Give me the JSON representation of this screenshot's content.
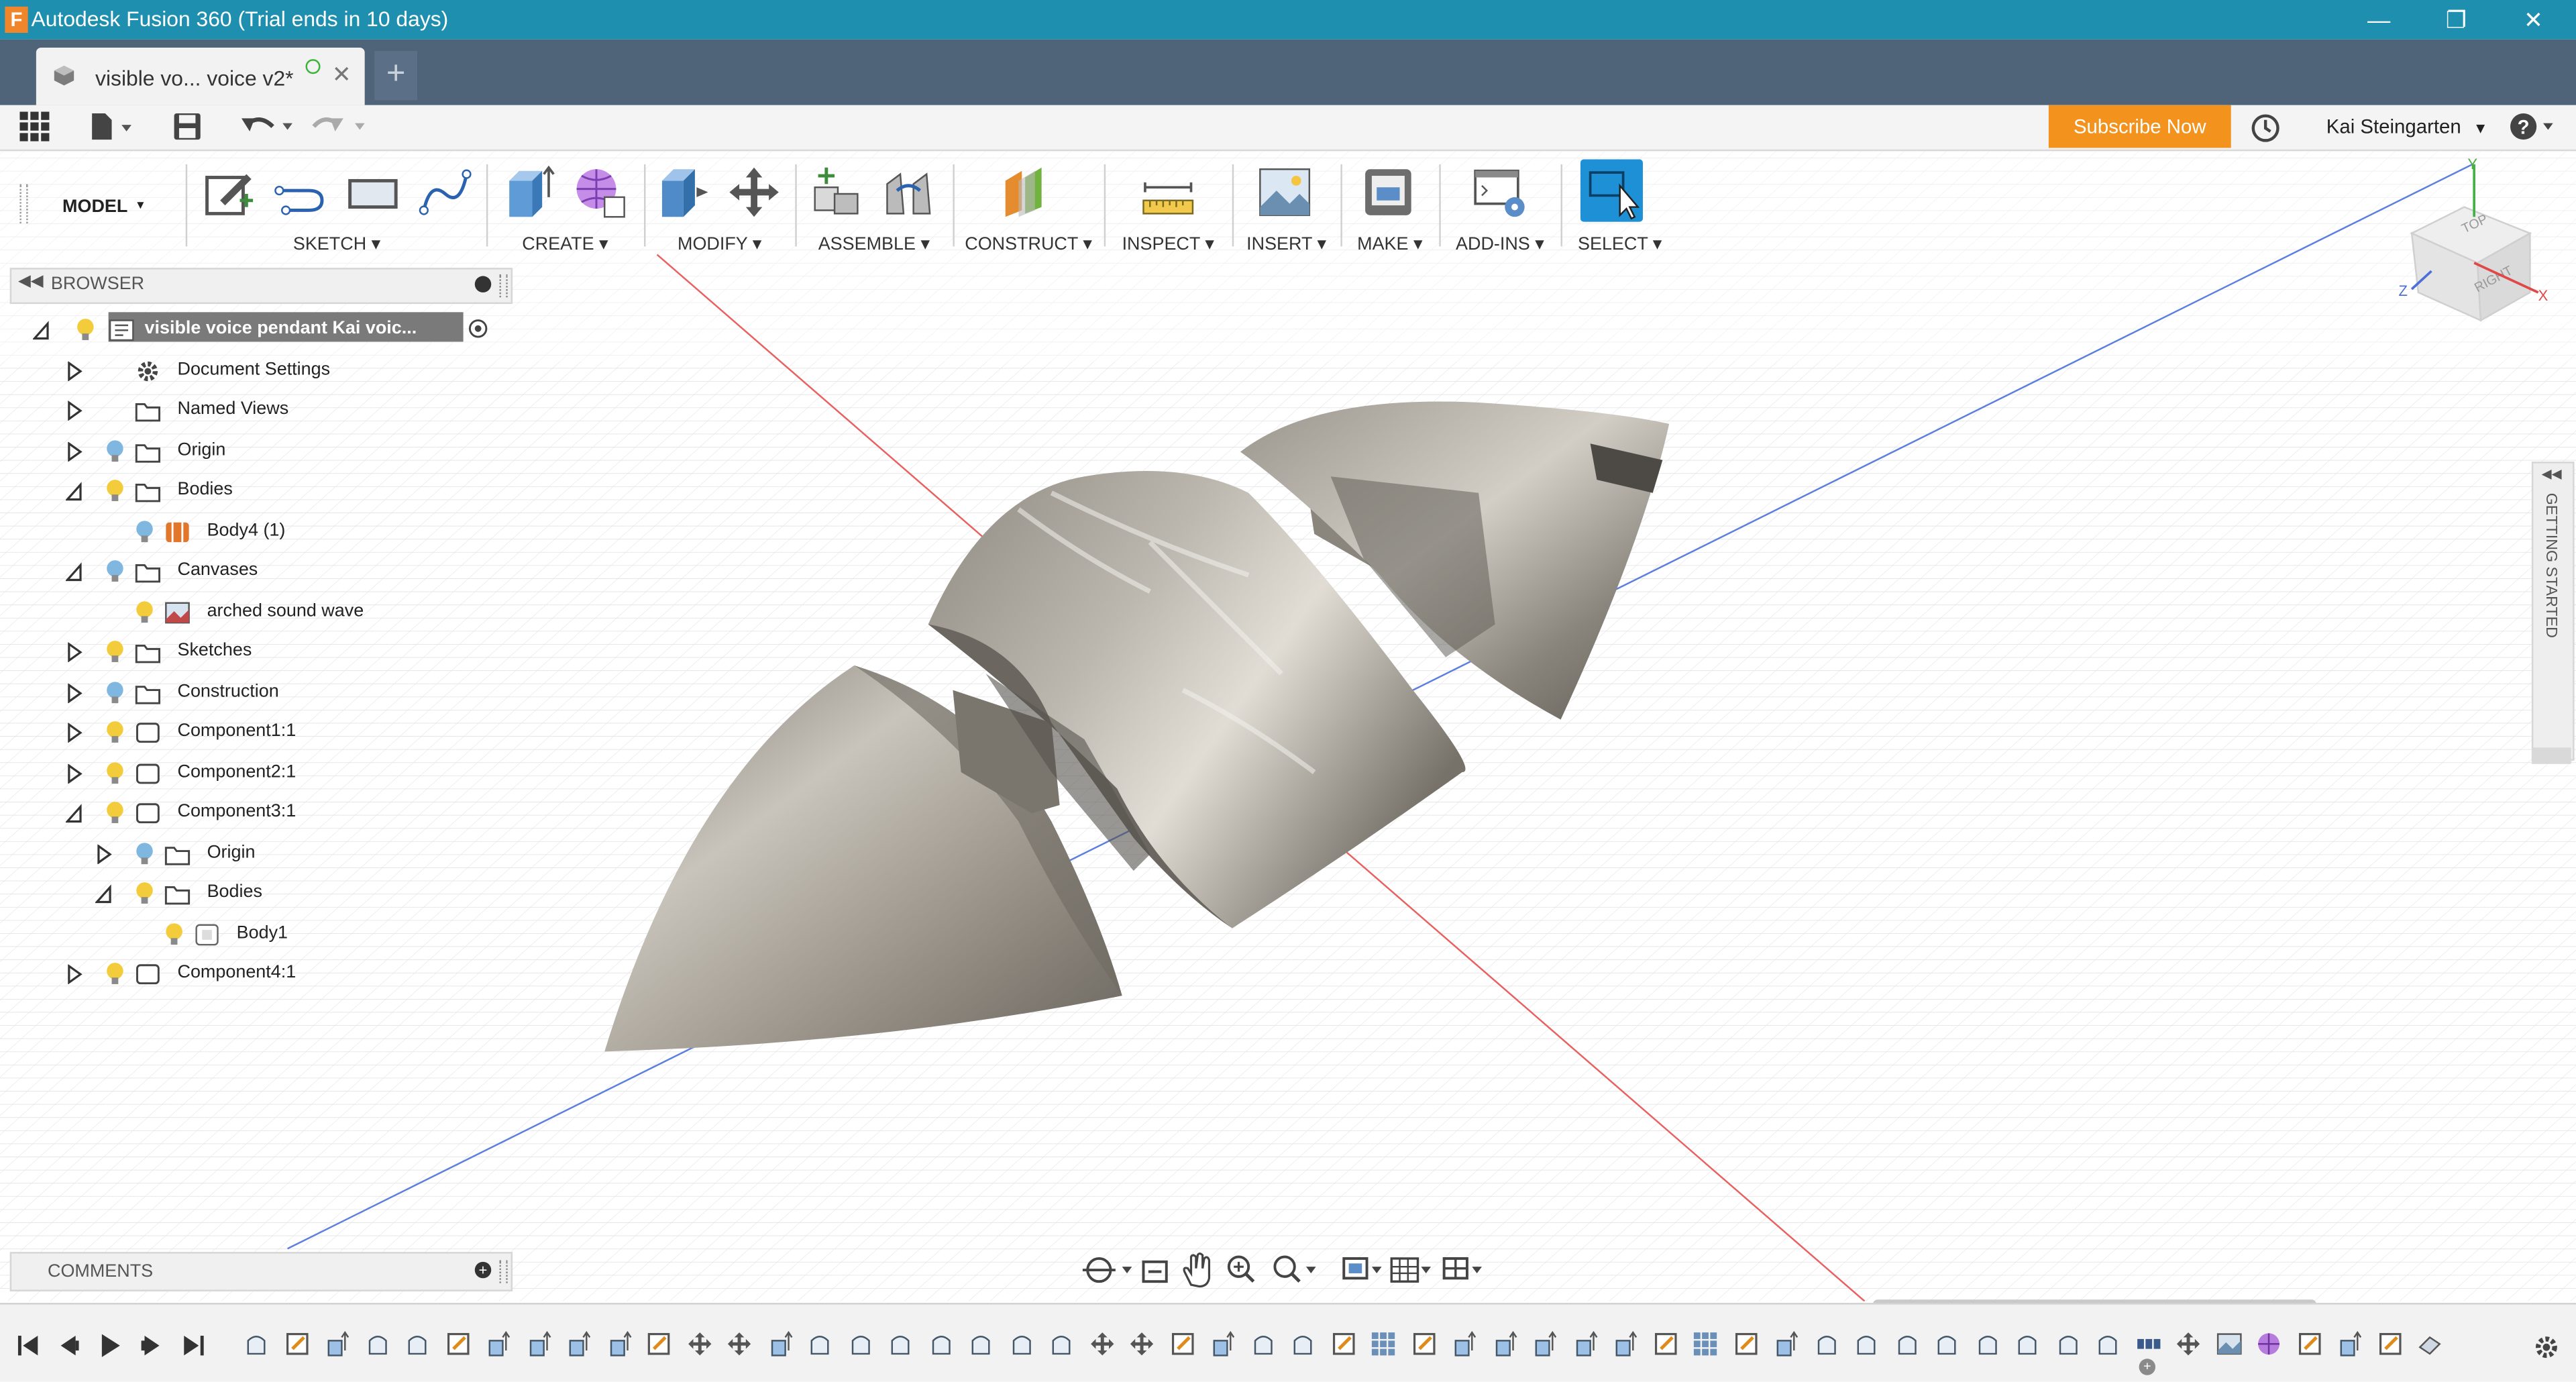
{
  "window": {
    "title": "Autodesk Fusion 360 (Trial ends in 10 days)",
    "logo_letter": "F",
    "controls": [
      "minimize-icon",
      "restore-icon",
      "close-icon"
    ]
  },
  "tabs": [
    {
      "label": "visible vo... voice v2*",
      "active": true
    }
  ],
  "quick_access": {
    "subscribe_label": "Subscribe Now",
    "user_label": "Kai Steingarten",
    "accent": "#f3931e"
  },
  "toolbar": {
    "workspace_label": "MODEL",
    "groups": [
      {
        "label": "SKETCH",
        "icons": [
          "create-sketch-icon",
          "line-icon",
          "rectangle-icon",
          "spline-icon"
        ]
      },
      {
        "label": "CREATE",
        "icons": [
          "extrude-icon",
          "form-icon"
        ]
      },
      {
        "label": "MODIFY",
        "icons": [
          "press-pull-icon",
          "move-icon"
        ]
      },
      {
        "label": "ASSEMBLE",
        "icons": [
          "new-component-icon",
          "joint-icon"
        ]
      },
      {
        "label": "CONSTRUCT",
        "icons": [
          "offset-plane-icon"
        ]
      },
      {
        "label": "INSPECT",
        "icons": [
          "measure-icon"
        ]
      },
      {
        "label": "INSERT",
        "icons": [
          "insert-image-icon"
        ]
      },
      {
        "label": "MAKE",
        "icons": [
          "3d-print-icon"
        ]
      },
      {
        "label": "ADD-INS",
        "icons": [
          "scripts-icon"
        ]
      },
      {
        "label": "SELECT",
        "icons": [
          "select-icon"
        ]
      }
    ]
  },
  "browser": {
    "header": "BROWSER",
    "tree": [
      {
        "label": "visible voice pendant Kai voic...",
        "depth": 0,
        "expanded": true,
        "icon": "document-icon",
        "bulb": true,
        "root": true
      },
      {
        "label": "Document Settings",
        "depth": 1,
        "expanded": false,
        "icon": "gear-icon",
        "bulb": false
      },
      {
        "label": "Named Views",
        "depth": 1,
        "expanded": false,
        "icon": "folder-icon",
        "bulb": false
      },
      {
        "label": "Origin",
        "depth": 1,
        "expanded": false,
        "icon": "folder-icon",
        "bulb": true,
        "bulb_color": "blue"
      },
      {
        "label": "Bodies",
        "depth": 1,
        "expanded": true,
        "icon": "folder-icon",
        "bulb": true
      },
      {
        "label": "Body4 (1)",
        "depth": 2,
        "leaf": true,
        "icon": "body-orange-icon",
        "bulb": true,
        "bulb_color": "blue"
      },
      {
        "label": "Canvases",
        "depth": 1,
        "expanded": true,
        "icon": "folder-icon",
        "bulb": true,
        "bulb_color": "blue"
      },
      {
        "label": "arched sound wave",
        "depth": 2,
        "leaf": true,
        "icon": "canvas-image-icon",
        "bulb": true
      },
      {
        "label": "Sketches",
        "depth": 1,
        "expanded": false,
        "icon": "folder-icon",
        "bulb": true
      },
      {
        "label": "Construction",
        "depth": 1,
        "expanded": false,
        "icon": "folder-icon",
        "bulb": true,
        "bulb_color": "blue"
      },
      {
        "label": "Component1:1",
        "depth": 1,
        "expanded": false,
        "icon": "component-icon",
        "bulb": true
      },
      {
        "label": "Component2:1",
        "depth": 1,
        "expanded": false,
        "icon": "component-icon",
        "bulb": true
      },
      {
        "label": "Component3:1",
        "depth": 1,
        "expanded": true,
        "icon": "component-icon",
        "bulb": true
      },
      {
        "label": "Origin",
        "depth": 2,
        "expanded": false,
        "icon": "folder-icon",
        "bulb": true,
        "bulb_color": "blue"
      },
      {
        "label": "Bodies",
        "depth": 2,
        "expanded": true,
        "icon": "folder-icon",
        "bulb": true
      },
      {
        "label": "Body1",
        "depth": 3,
        "leaf": true,
        "icon": "body-white-icon",
        "bulb": true
      },
      {
        "label": "Component4:1",
        "depth": 1,
        "expanded": false,
        "icon": "component-icon",
        "bulb": true
      }
    ]
  },
  "comments": {
    "header": "COMMENTS"
  },
  "getting_started": {
    "label": "GETTING STARTED"
  },
  "viewcube": {
    "top": "TOP",
    "right": "RIGHT",
    "axis_x": "X",
    "axis_y": "Y",
    "axis_z": "Z"
  },
  "navbar": {
    "icons": [
      "orbit-icon",
      "look-at-icon",
      "pan-icon",
      "zoom-icon",
      "fit-icon",
      "display-settings-icon",
      "grid-icon",
      "viewports-icon"
    ]
  },
  "timeline": {
    "controls": [
      "skip-start-icon",
      "step-back-icon",
      "play-icon",
      "step-forward-icon",
      "skip-end-icon"
    ],
    "features": [
      "body",
      "sketch",
      "extrude",
      "body",
      "body",
      "sketch",
      "extrude",
      "extrude",
      "extrude",
      "extrude",
      "sketch",
      "move",
      "move",
      "extrude",
      "body",
      "body",
      "body",
      "body",
      "body",
      "body",
      "body",
      "move",
      "move",
      "sketch",
      "extrude",
      "body",
      "body",
      "sketch",
      "pattern",
      "sketch",
      "extrude",
      "extrude",
      "extrude",
      "extrude",
      "extrude",
      "sketch",
      "pattern",
      "sketch",
      "extrude",
      "body",
      "body",
      "body",
      "body",
      "body",
      "body",
      "body",
      "body",
      "pattern-line",
      "move",
      "canvas",
      "form",
      "sketch",
      "extrude",
      "sketch",
      "component"
    ]
  }
}
